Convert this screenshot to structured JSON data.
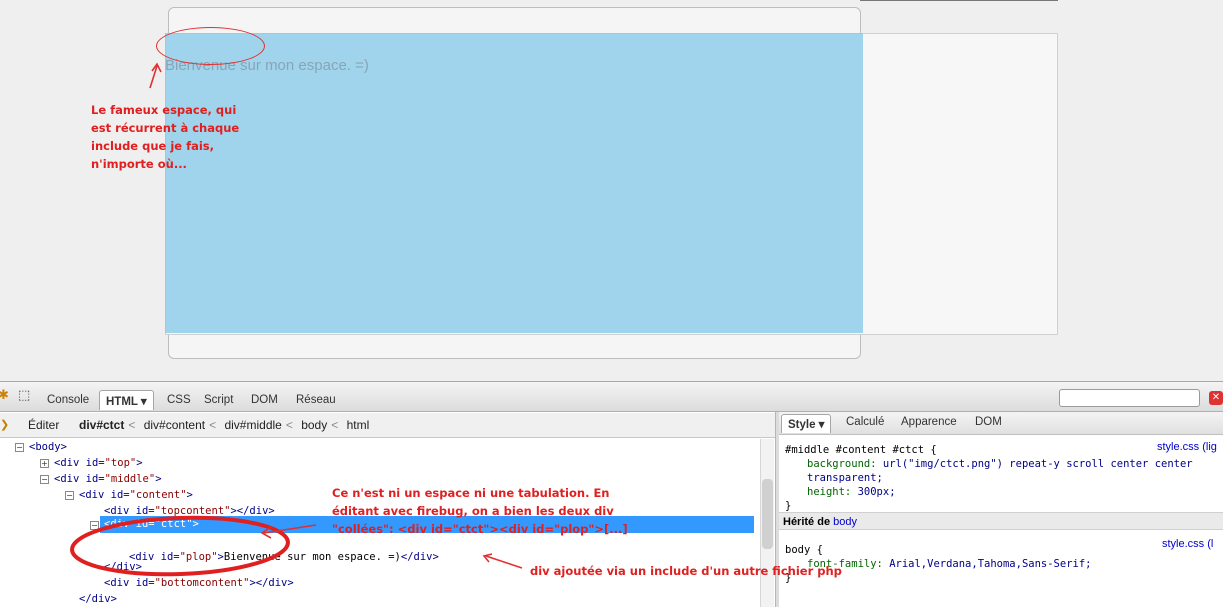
{
  "page": {
    "welcome_text": "Bienvenue sur mon espace. =)"
  },
  "annotations": {
    "note_espace": "Le fameux espace, qui\nest récurrent à chaque\ninclude que je fais,\nn'importe où...",
    "note_tabulation": "Ce n'est ni un espace ni une tabulation. En\néditant avec firebug, on a bien les deux div\n\"collées\": <div id=\"ctct\"><div id=\"plop\">[...]",
    "note_include": "div ajoutée via un include d'un autre fichier php",
    "color": "#e02020"
  },
  "firebug": {
    "tabs": [
      "Console",
      "HTML ▾",
      "CSS",
      "Script",
      "DOM",
      "Réseau"
    ],
    "active_tab": "HTML",
    "edit_label": "Éditer",
    "breadcrumbs": [
      "div#ctct",
      "div#content",
      "div#middle",
      "body",
      "html"
    ],
    "html_tree": {
      "body_open": "<body>",
      "div_top": {
        "tag": "div",
        "id": "top"
      },
      "div_middle": {
        "tag": "div",
        "id": "middle"
      },
      "div_content": {
        "tag": "div",
        "id": "content"
      },
      "div_topcontent": {
        "tag": "div",
        "id": "topcontent"
      },
      "div_ctct": {
        "tag": "div",
        "id": "ctct"
      },
      "div_plop": {
        "tag": "div",
        "id": "plop",
        "text": "Bienvenue sur mon espace. =)"
      },
      "div_close": "</div>",
      "div_bottomcontent": {
        "tag": "div",
        "id": "bottomcontent"
      },
      "div_close_2": "</div>"
    },
    "side_tabs": [
      "Style ▾",
      "Calculé",
      "Apparence",
      "DOM"
    ],
    "style_rule": {
      "selector": "#middle #content #ctct {",
      "source": "style.css (lig",
      "background_prop": "background:",
      "background_val": "url(\"img/ctct.png\") repeat-y scroll center center",
      "background_val_2": "transparent;",
      "height_prop": "height:",
      "height_val": "300px;",
      "close": "}"
    },
    "inherited_label": "Hérité de",
    "inherited_from": "body",
    "body_rule": {
      "selector": "body {",
      "source": "style.css (l",
      "font_prop": "font-family:",
      "font_val": "Arial,Verdana,Tahoma,Sans-Serif;",
      "close": "}"
    }
  },
  "colors": {
    "highlight": "#86cae9",
    "selection": "#3399ff",
    "annotation": "#e02020"
  }
}
